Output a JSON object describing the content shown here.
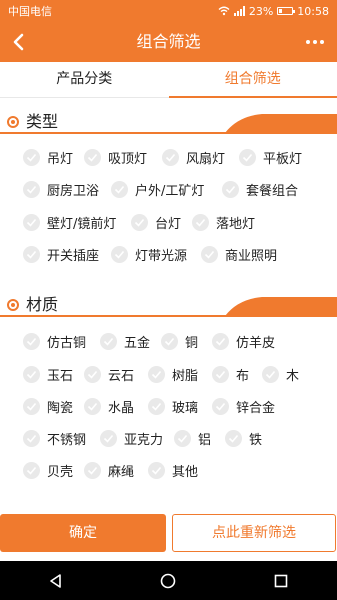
{
  "status_bar": {
    "carrier": "中国电信",
    "battery": "23%",
    "time": "10:58"
  },
  "app_bar": {
    "title": "组合筛选"
  },
  "tabs": [
    {
      "label": "产品分类",
      "active": false
    },
    {
      "label": "组合筛选",
      "active": true
    }
  ],
  "type_section": {
    "title": "类型",
    "options": [
      "吊灯",
      "吸顶灯",
      "风扇灯",
      "平板灯",
      "厨房卫浴",
      "户外/工矿灯",
      "套餐组合",
      "壁灯/镜前灯",
      "台灯",
      "落地灯",
      "开关插座",
      "灯带光源",
      "商业照明"
    ]
  },
  "material_section": {
    "title": "材质",
    "options": [
      "仿古铜",
      "五金",
      "铜",
      "仿羊皮",
      "玉石",
      "云石",
      "树脂",
      "布",
      "木",
      "陶瓷",
      "水晶",
      "玻璃",
      "锌合金",
      "不锈钢",
      "亚克力",
      "铝",
      "铁",
      "贝壳",
      "麻绳",
      "其他"
    ]
  },
  "buttons": {
    "confirm": "确定",
    "reset": "点此重新筛选"
  },
  "colors": {
    "accent": "#f07a2e",
    "unchecked": "#e9e9e9",
    "check_mark": "#ffffff"
  }
}
